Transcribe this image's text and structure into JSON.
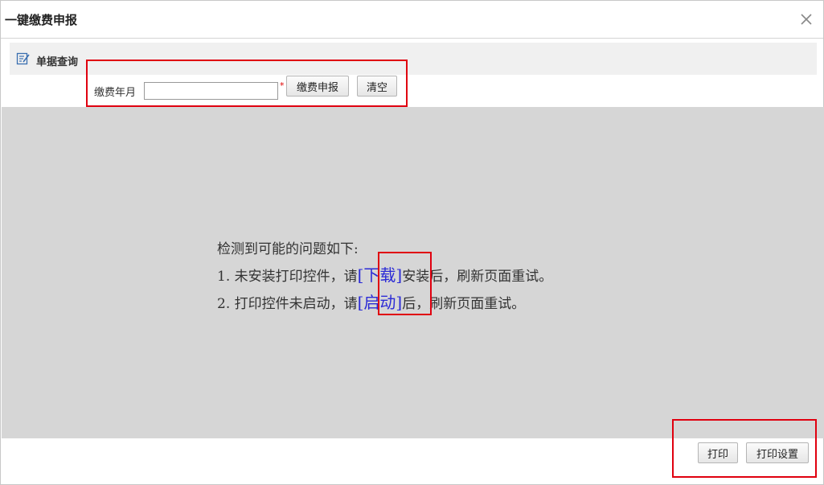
{
  "dialog": {
    "title": "一键缴费申报",
    "close_icon": "close-icon"
  },
  "section": {
    "icon": "edit-form-icon",
    "title": "单据查询"
  },
  "form": {
    "month_label": "缴费年月",
    "month_value": "",
    "month_placeholder": "",
    "required_mark": "*",
    "submit_label": "缴费申报",
    "clear_label": "清空"
  },
  "message": {
    "heading": "检测到可能的问题如下:",
    "line1_prefix": "1. 未安装打印控件，请",
    "line1_link": "[下载]",
    "line1_suffix": "安装后，刷新页面重试。",
    "line2_prefix": "2. 打印控件未启动，请",
    "line2_link": "[启动]",
    "line2_suffix": "后，刷新页面重试。",
    "link_color": "#2b2bd6"
  },
  "footer": {
    "print_label": "打印",
    "print_settings_label": "打印设置"
  },
  "colors": {
    "highlight": "#e0000f",
    "content_bg": "#d6d6d6",
    "section_bg": "#f0f0f0"
  }
}
